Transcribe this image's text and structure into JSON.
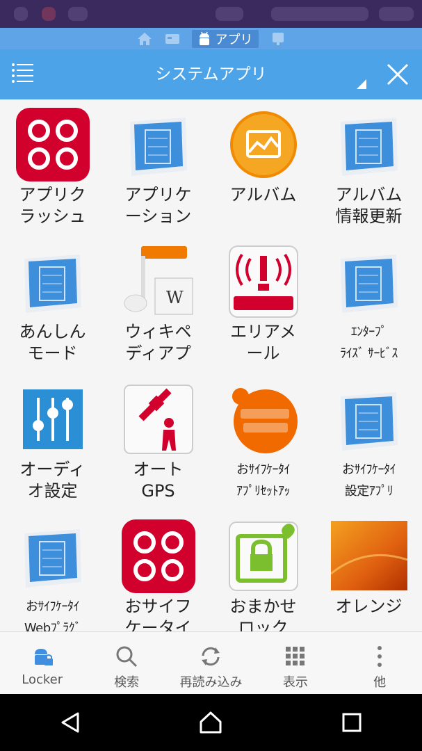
{
  "breadcrumb": {
    "active_label": "アプリ"
  },
  "header": {
    "title": "システムアプリ"
  },
  "apps": [
    {
      "label": "アプリク\nラッシュ",
      "icon": "app-crush-icon"
    },
    {
      "label": "アプリケ\nーション",
      "icon": "blueprint-icon"
    },
    {
      "label": "アルバム",
      "icon": "album-icon"
    },
    {
      "label": "アルバム\n情報更新",
      "icon": "blueprint-icon"
    },
    {
      "label": "あんしん\nモード",
      "icon": "blueprint-icon"
    },
    {
      "label": "ウィキペ\nディアプ",
      "icon": "wikipedia-music-icon"
    },
    {
      "label": "エリアメ\nール",
      "icon": "area-mail-icon"
    },
    {
      "label": "ｴﾝﾀｰﾌﾟ\nﾗｲｽﾞ ｻｰﾋﾞｽ",
      "icon": "blueprint-icon"
    },
    {
      "label": "オーディ\nオ設定",
      "icon": "audio-settings-icon"
    },
    {
      "label": "オート\nGPS",
      "icon": "auto-gps-icon"
    },
    {
      "label": "おｻｲﾌｹｰﾀｲ\nｱﾌﾟﾘｾｯﾄｱｯ",
      "icon": "osaifu-keitai-icon"
    },
    {
      "label": "おｻｲﾌｹｰﾀｲ\n設定ｱﾌﾟﾘ",
      "icon": "blueprint-icon"
    },
    {
      "label": "おｻｲﾌｹｰﾀｲ\nWebﾌﾟﾗｸﾞ",
      "icon": "blueprint-icon"
    },
    {
      "label": "おサイフ\nケータイ",
      "icon": "app-crush-icon"
    },
    {
      "label": "おまかせ\nロック",
      "icon": "omakase-lock-icon"
    },
    {
      "label": "オレンジ",
      "icon": "orange-wallpaper-icon"
    }
  ],
  "toolbar": {
    "locker": "Locker",
    "search": "検索",
    "reload": "再読み込み",
    "view": "表示",
    "more": "他"
  },
  "colors": {
    "header": "#4da3e8",
    "crumb": "#5fa4e6",
    "red": "#d2002c",
    "orange": "#f08a00"
  }
}
